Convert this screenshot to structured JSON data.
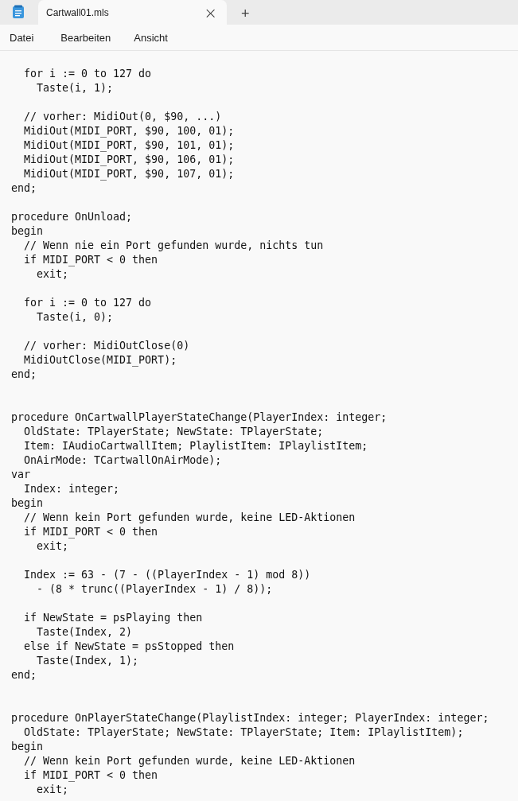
{
  "tabs": [
    {
      "title": "Cartwall01.mls",
      "selected": true,
      "close": "×"
    }
  ],
  "new_tab": "+",
  "menu": [
    "Datei",
    "Bearbeiten",
    "Ansicht"
  ],
  "editor": {
    "blocks": [
      {
        "kind": "block",
        "lines": [
          "  for i := 0 to 127 do",
          "    Taste(i, 1);"
        ]
      },
      {
        "kind": "block",
        "lines": [
          "  // vorher: MidiOut(0, $90, ...)",
          "  MidiOut(MIDI_PORT, $90, 100, 01);",
          "  MidiOut(MIDI_PORT, $90, 101, 01);",
          "  MidiOut(MIDI_PORT, $90, 106, 01);",
          "  MidiOut(MIDI_PORT, $90, 107, 01);",
          "end;"
        ]
      },
      {
        "kind": "block",
        "lines": [
          "procedure OnUnload;",
          "begin",
          "  // Wenn nie ein Port gefunden wurde, nichts tun",
          "  if MIDI_PORT < 0 then",
          "    exit;"
        ]
      },
      {
        "kind": "block",
        "lines": [
          "  for i := 0 to 127 do",
          "    Taste(i, 0);"
        ]
      },
      {
        "kind": "block",
        "lines": [
          "  // vorher: MidiOutClose(0)",
          "  MidiOutClose(MIDI_PORT);",
          "end;"
        ]
      },
      {
        "kind": "section",
        "lines": [
          "procedure OnCartwallPlayerStateChange(PlayerIndex: integer;",
          "  OldState: TPlayerState; NewState: TPlayerState;",
          "  Item: IAudioCartwallItem; PlaylistItem: IPlaylistItem;",
          "  OnAirMode: TCartwallOnAirMode);",
          "var",
          "  Index: integer;",
          "begin",
          "  // Wenn kein Port gefunden wurde, keine LED-Aktionen",
          "  if MIDI_PORT < 0 then",
          "    exit;"
        ]
      },
      {
        "kind": "block",
        "lines": [
          "  Index := 63 - (7 - ((PlayerIndex - 1) mod 8))",
          "    - (8 * trunc((PlayerIndex - 1) / 8));"
        ]
      },
      {
        "kind": "block",
        "lines": [
          "  if NewState = psPlaying then",
          "    Taste(Index, 2)",
          "  else if NewState = psStopped then",
          "    Taste(Index, 1);",
          "end;"
        ]
      },
      {
        "kind": "section",
        "lines": [
          "procedure OnPlayerStateChange(PlaylistIndex: integer; PlayerIndex: integer;",
          "  OldState: TPlayerState; NewState: TPlayerState; Item: IPlaylistItem);",
          "begin",
          "  // Wenn kein Port gefunden wurde, keine LED-Aktionen",
          "  if MIDI_PORT < 0 then",
          "    exit;"
        ]
      }
    ]
  }
}
